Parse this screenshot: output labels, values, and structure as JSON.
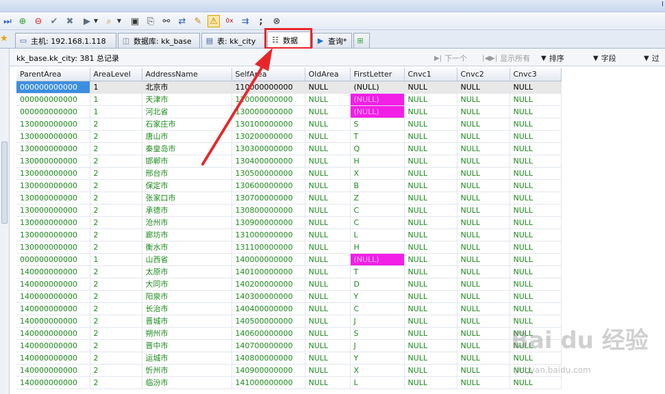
{
  "titlebar": {
    "corner": "I"
  },
  "toolbar": {
    "icons": [
      "step-icon",
      "add-icon",
      "remove-icon",
      "check-icon",
      "cancel-icon",
      "run-icon",
      "dropdown-icon",
      "query-icon",
      "dropdown-icon",
      "save-icon",
      "save-as-icon",
      "binoculars-icon",
      "replace-icon",
      "edit-icon",
      "warning-icon",
      "hex-icon",
      "export-icon",
      "semicolon-icon",
      "close-icon"
    ]
  },
  "tabs": [
    {
      "icon": "computer-icon",
      "label": "主机: 192.168.1.118"
    },
    {
      "icon": "database-icon",
      "label": "数据库: kk_base"
    },
    {
      "icon": "table-icon",
      "label": "表: kk_city"
    },
    {
      "icon": "grid-icon",
      "label": "数据"
    },
    {
      "icon": "play-icon",
      "label": "查询*"
    },
    {
      "icon": "new-tab-icon",
      "label": ""
    }
  ],
  "info": {
    "summary": "kk_base.kk_city: 381 总记录",
    "next": "下一个",
    "show_all": "显示所有",
    "sort": "排序",
    "fields": "字段",
    "filter": "过"
  },
  "colors": {
    "selected_cell": "#3c8fe0",
    "null_highlight": "#f21fe6",
    "data_text": "#1a8a1a",
    "annotation_red": "#e8262a"
  },
  "grid": {
    "columns": [
      "ParentArea",
      "AreaLevel",
      "AddressName",
      "SelfArea",
      "OldArea",
      "FirstLetter",
      "Cnvc1",
      "Cnvc2",
      "Cnvc3"
    ],
    "rows": [
      [
        "000000000000",
        "1",
        "北京市",
        "110000000000",
        "NULL",
        "(NULL)",
        "NULL",
        "NULL",
        "NULL"
      ],
      [
        "000000000000",
        "1",
        "天津市",
        "120000000000",
        "NULL",
        "(NULL)",
        "NULL",
        "NULL",
        "NULL"
      ],
      [
        "000000000000",
        "1",
        "河北省",
        "130000000000",
        "NULL",
        "(NULL)",
        "NULL",
        "NULL",
        "NULL"
      ],
      [
        "130000000000",
        "2",
        "石家庄市",
        "130100000000",
        "NULL",
        "S",
        "NULL",
        "NULL",
        "NULL"
      ],
      [
        "130000000000",
        "2",
        "唐山市",
        "130200000000",
        "NULL",
        "T",
        "NULL",
        "NULL",
        "NULL"
      ],
      [
        "130000000000",
        "2",
        "秦皇岛市",
        "130300000000",
        "NULL",
        "Q",
        "NULL",
        "NULL",
        "NULL"
      ],
      [
        "130000000000",
        "2",
        "邯郸市",
        "130400000000",
        "NULL",
        "H",
        "NULL",
        "NULL",
        "NULL"
      ],
      [
        "130000000000",
        "2",
        "邢台市",
        "130500000000",
        "NULL",
        "X",
        "NULL",
        "NULL",
        "NULL"
      ],
      [
        "130000000000",
        "2",
        "保定市",
        "130600000000",
        "NULL",
        "B",
        "NULL",
        "NULL",
        "NULL"
      ],
      [
        "130000000000",
        "2",
        "张家口市",
        "130700000000",
        "NULL",
        "Z",
        "NULL",
        "NULL",
        "NULL"
      ],
      [
        "130000000000",
        "2",
        "承德市",
        "130800000000",
        "NULL",
        "C",
        "NULL",
        "NULL",
        "NULL"
      ],
      [
        "130000000000",
        "2",
        "沧州市",
        "130900000000",
        "NULL",
        "C",
        "NULL",
        "NULL",
        "NULL"
      ],
      [
        "130000000000",
        "2",
        "廊坊市",
        "131000000000",
        "NULL",
        "L",
        "NULL",
        "NULL",
        "NULL"
      ],
      [
        "130000000000",
        "2",
        "衡水市",
        "131100000000",
        "NULL",
        "H",
        "NULL",
        "NULL",
        "NULL"
      ],
      [
        "000000000000",
        "1",
        "山西省",
        "140000000000",
        "NULL",
        "(NULL)",
        "NULL",
        "NULL",
        "NULL"
      ],
      [
        "140000000000",
        "2",
        "太原市",
        "140100000000",
        "NULL",
        "T",
        "NULL",
        "NULL",
        "NULL"
      ],
      [
        "140000000000",
        "2",
        "大同市",
        "140200000000",
        "NULL",
        "D",
        "NULL",
        "NULL",
        "NULL"
      ],
      [
        "140000000000",
        "2",
        "阳泉市",
        "140300000000",
        "NULL",
        "Y",
        "NULL",
        "NULL",
        "NULL"
      ],
      [
        "140000000000",
        "2",
        "长治市",
        "140400000000",
        "NULL",
        "C",
        "NULL",
        "NULL",
        "NULL"
      ],
      [
        "140000000000",
        "2",
        "晋城市",
        "140500000000",
        "NULL",
        "J",
        "NULL",
        "NULL",
        "NULL"
      ],
      [
        "140000000000",
        "2",
        "朔州市",
        "140600000000",
        "NULL",
        "S",
        "NULL",
        "NULL",
        "NULL"
      ],
      [
        "140000000000",
        "2",
        "晋中市",
        "140700000000",
        "NULL",
        "J",
        "NULL",
        "NULL",
        "NULL"
      ],
      [
        "140000000000",
        "2",
        "运城市",
        "140800000000",
        "NULL",
        "Y",
        "NULL",
        "NULL",
        "NULL"
      ],
      [
        "140000000000",
        "2",
        "忻州市",
        "140900000000",
        "NULL",
        "X",
        "NULL",
        "NULL",
        "NULL"
      ],
      [
        "140000000000",
        "2",
        "临汾市",
        "141000000000",
        "NULL",
        "L",
        "NULL",
        "NULL",
        "NULL"
      ]
    ],
    "pink_rows": [
      1,
      2,
      14
    ]
  },
  "watermark": {
    "main": "Bai du 经验",
    "sub": "jingyan.baidu.com"
  }
}
